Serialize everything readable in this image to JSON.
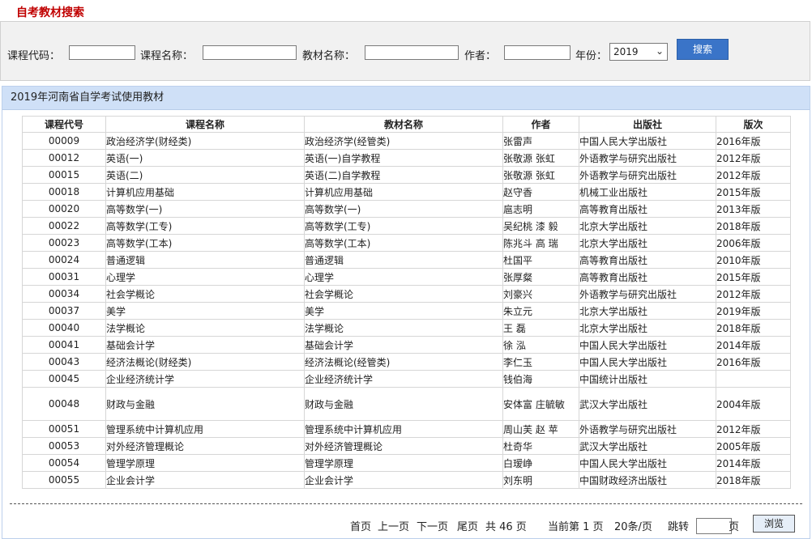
{
  "page_title": "自考教材搜索",
  "search": {
    "course_code_label": "课程代码：",
    "course_name_label": "课程名称：",
    "textbook_name_label": "教材名称：",
    "author_label": "作者：",
    "year_label": "年份：",
    "year_value": "2019",
    "search_button": "搜索"
  },
  "results": {
    "header": "2019年河南省自学考试使用教材",
    "columns": [
      "课程代号",
      "课程名称",
      "教材名称",
      "作者",
      "出版社",
      "版次"
    ],
    "rows": [
      [
        "00009",
        "政治经济学(财经类)",
        "政治经济学(经管类)",
        "张雷声",
        "中国人民大学出版社",
        "2016年版"
      ],
      [
        "00012",
        "英语(一)",
        "英语(一)自学教程",
        "张敬源 张虹",
        "外语教学与研究出版社",
        "2012年版"
      ],
      [
        "00015",
        "英语(二)",
        "英语(二)自学教程",
        "张敬源 张虹",
        "外语教学与研究出版社",
        "2012年版"
      ],
      [
        "00018",
        "计算机应用基础",
        "计算机应用基础",
        "赵守香",
        "机械工业出版社",
        "2015年版"
      ],
      [
        "00020",
        "高等数学(一)",
        "高等数学(一)",
        "扈志明",
        "高等教育出版社",
        "2013年版"
      ],
      [
        "00022",
        "高等数学(工专)",
        "高等数学(工专)",
        "吴纪桃 漆 毅",
        "北京大学出版社",
        "2018年版"
      ],
      [
        "00023",
        "高等数学(工本)",
        "高等数学(工本)",
        "陈兆斗 高 瑞",
        "北京大学出版社",
        "2006年版"
      ],
      [
        "00024",
        "普通逻辑",
        "普通逻辑",
        "杜国平",
        "高等教育出版社",
        "2010年版"
      ],
      [
        "00031",
        "心理学",
        "心理学",
        "张厚粲",
        "高等教育出版社",
        "2015年版"
      ],
      [
        "00034",
        "社会学概论",
        "社会学概论",
        "刘豪兴",
        "外语教学与研究出版社",
        "2012年版"
      ],
      [
        "00037",
        "美学",
        "美学",
        "朱立元",
        "北京大学出版社",
        "2019年版"
      ],
      [
        "00040",
        "法学概论",
        "法学概论",
        "王 磊",
        "北京大学出版社",
        "2018年版"
      ],
      [
        "00041",
        "基础会计学",
        "基础会计学",
        "徐 泓",
        "中国人民大学出版社",
        "2014年版"
      ],
      [
        "00043",
        "经济法概论(财经类)",
        "经济法概论(经管类)",
        "李仁玉",
        "中国人民大学出版社",
        "2016年版"
      ],
      [
        "00045",
        "企业经济统计学",
        "企业经济统计学",
        "钱伯海",
        "中国统计出版社",
        ""
      ],
      [
        "00048",
        "财政与金融",
        "财政与金融",
        "安体富 庄毓敏",
        "武汉大学出版社",
        "2004年版"
      ],
      [
        "00051",
        "管理系统中计算机应用",
        "管理系统中计算机应用",
        "周山芙 赵 苹",
        "外语教学与研究出版社",
        "2012年版"
      ],
      [
        "00053",
        "对外经济管理概论",
        "对外经济管理概论",
        "杜奇华",
        "武汉大学出版社",
        "2005年版"
      ],
      [
        "00054",
        "管理学原理",
        "管理学原理",
        "白瑷峥",
        "中国人民大学出版社",
        "2014年版"
      ],
      [
        "00055",
        "企业会计学",
        "企业会计学",
        "刘东明",
        "中国财政经济出版社",
        "2018年版"
      ]
    ]
  },
  "pager": {
    "first": "首页",
    "prev": "上一页",
    "next": "下一页",
    "last": "尾页",
    "total_text": "共 46 页",
    "current_text": "当前第 1 页",
    "per_page_text": "20条/页",
    "jump_label": "跳转",
    "page_suffix": "页",
    "browse_button": "浏览"
  }
}
